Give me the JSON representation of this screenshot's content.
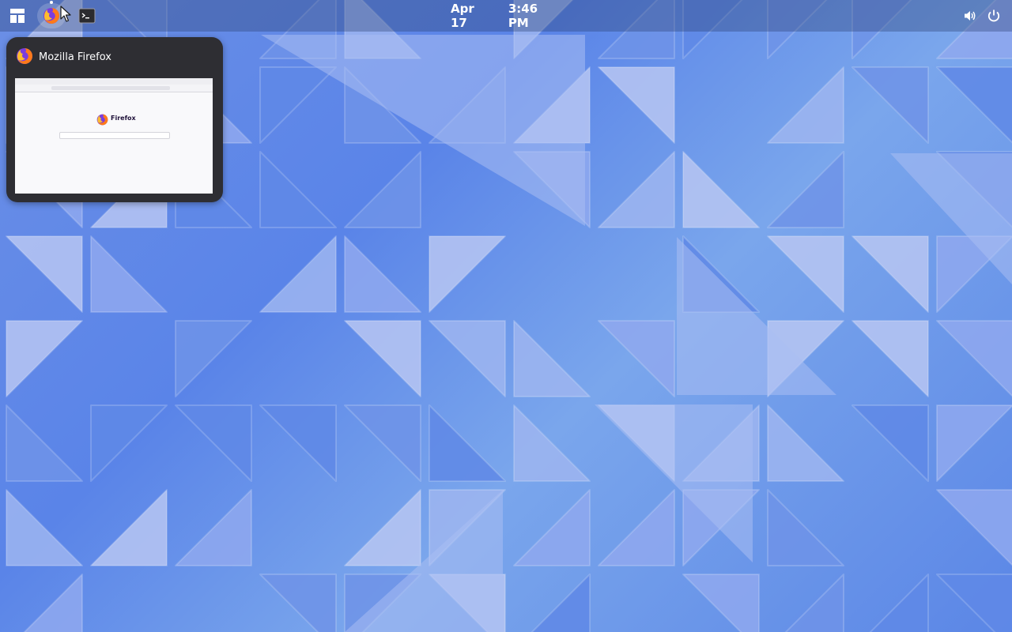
{
  "topbar": {
    "date": "Apr 17",
    "time": "3:46 PM",
    "dock": [
      {
        "name": "activities",
        "icon": "activities-grid-icon"
      },
      {
        "name": "firefox",
        "icon": "firefox-icon",
        "running": true
      },
      {
        "name": "terminal",
        "icon": "terminal-icon"
      }
    ],
    "status_icons": [
      "volume-icon",
      "power-icon"
    ]
  },
  "window_preview": {
    "app_name": "Mozilla Firefox",
    "app_icon": "firefox-icon",
    "thumbnail_brand": "Firefox"
  },
  "colors": {
    "topbar_text": "#ffffff",
    "preview_bg": "#2e2e33",
    "wallpaper_base": "#5a84e8",
    "wallpaper_light": "#b7c6f2"
  }
}
